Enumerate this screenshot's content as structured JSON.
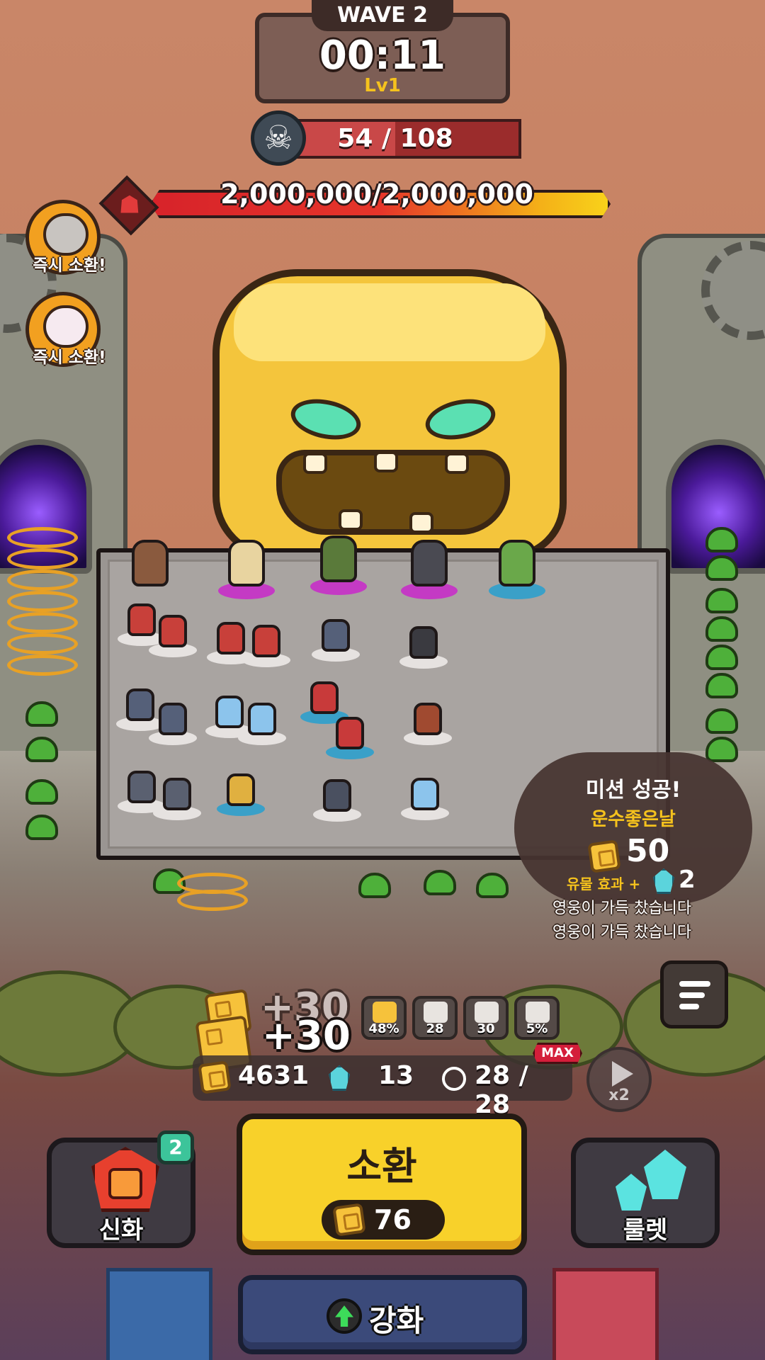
{
  "hud": {
    "wave_label": "WAVE 2",
    "timer": "00:11",
    "level": "Lv1",
    "kills_text": "54 / 108",
    "kills_fraction": 0.5,
    "boss_hp_text": "2,000,000/2,000,000",
    "boss_hp_fraction": 1.0
  },
  "instant_summons": [
    {
      "label": "즉시 소환!",
      "icon": "vehicle-hero-icon"
    },
    {
      "label": "즉시 소환!",
      "icon": "cat-hero-icon"
    }
  ],
  "mission": {
    "title": "미션 성공!",
    "name": "운수좋은날",
    "reward_gold": "50",
    "relic_label": "유물 효과 +",
    "relic_gems": "2"
  },
  "log_lines": [
    "영웅이 가득 찼습니다",
    "영웅이 가득 찼습니다"
  ],
  "floating": [
    "+30",
    "+30"
  ],
  "stats": [
    {
      "icon": "gold-buff-icon",
      "value": "48%"
    },
    {
      "icon": "attack-speed-icon",
      "value": "28"
    },
    {
      "icon": "power-icon",
      "value": "30"
    },
    {
      "icon": "crit-icon",
      "value": "5%"
    }
  ],
  "resources": {
    "gold": "4631",
    "gems": "13",
    "heroes": "28 / 28",
    "max_badge": "MAX",
    "speed": "x2"
  },
  "buttons": {
    "myth_label": "신화",
    "myth_badge": "2",
    "summon_label": "소환",
    "summon_cost": "76",
    "roulette_label": "룰렛",
    "upgrade_label": "강화"
  },
  "colors": {
    "accent": "#f8d12a",
    "boss_bar": "#e6352a",
    "gold": "#f6c23b",
    "gem": "#5bd4dc"
  }
}
